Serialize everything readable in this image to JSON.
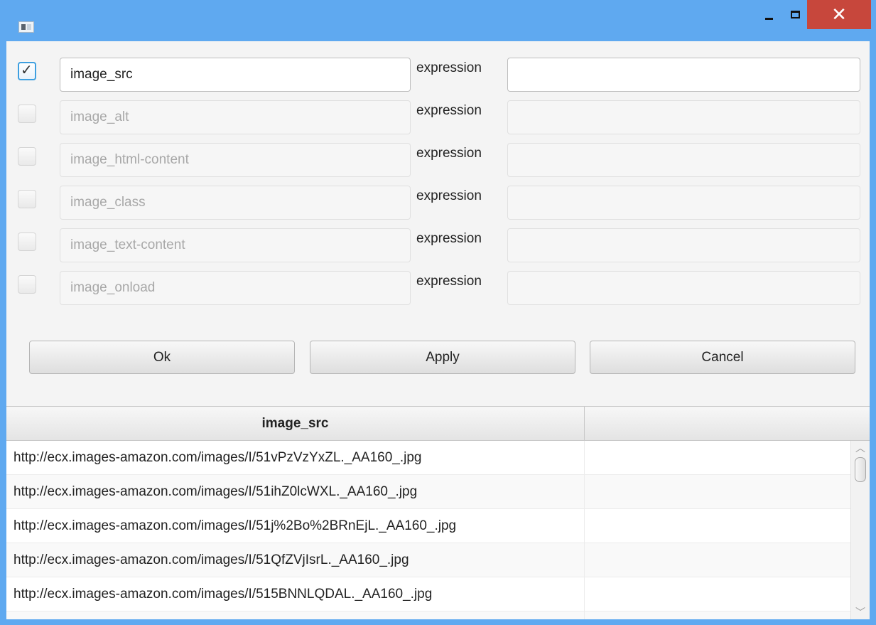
{
  "titlebar": {
    "app_icon": "window-app-icon",
    "minimize_icon": "minimize-icon",
    "maximize_icon": "maximize-icon",
    "close_icon": "close-icon",
    "close_glyph": "✕",
    "accent": "#5fa9f0",
    "close_color": "#c7473c"
  },
  "fields": [
    {
      "checked": true,
      "enabled": true,
      "name": "image_src",
      "expression_label": "expression",
      "expression_value": ""
    },
    {
      "checked": false,
      "enabled": false,
      "name": "image_alt",
      "expression_label": "expression",
      "expression_value": ""
    },
    {
      "checked": false,
      "enabled": false,
      "name": "image_html-content",
      "expression_label": "expression",
      "expression_value": ""
    },
    {
      "checked": false,
      "enabled": false,
      "name": "image_class",
      "expression_label": "expression",
      "expression_value": ""
    },
    {
      "checked": false,
      "enabled": false,
      "name": "image_text-content",
      "expression_label": "expression",
      "expression_value": ""
    },
    {
      "checked": false,
      "enabled": false,
      "name": "image_onload",
      "expression_label": "expression",
      "expression_value": ""
    }
  ],
  "buttons": {
    "ok": "Ok",
    "apply": "Apply",
    "cancel": "Cancel"
  },
  "table": {
    "columns": [
      "image_src",
      ""
    ],
    "rows": [
      [
        "http://ecx.images-amazon.com/images/I/51vPzVzYxZL._AA160_.jpg",
        ""
      ],
      [
        "http://ecx.images-amazon.com/images/I/51ihZ0lcWXL._AA160_.jpg",
        ""
      ],
      [
        "http://ecx.images-amazon.com/images/I/51j%2Bo%2BRnEjL._AA160_.jpg",
        ""
      ],
      [
        "http://ecx.images-amazon.com/images/I/51QfZVjIsrL._AA160_.jpg",
        ""
      ],
      [
        "http://ecx.images-amazon.com/images/I/515BNNLQDAL._AA160_.jpg",
        ""
      ]
    ]
  },
  "scrollbar": {
    "up_icon": "scroll-up-arrow-icon",
    "down_icon": "scroll-down-arrow-icon"
  },
  "checkbox_glyph": "✓"
}
